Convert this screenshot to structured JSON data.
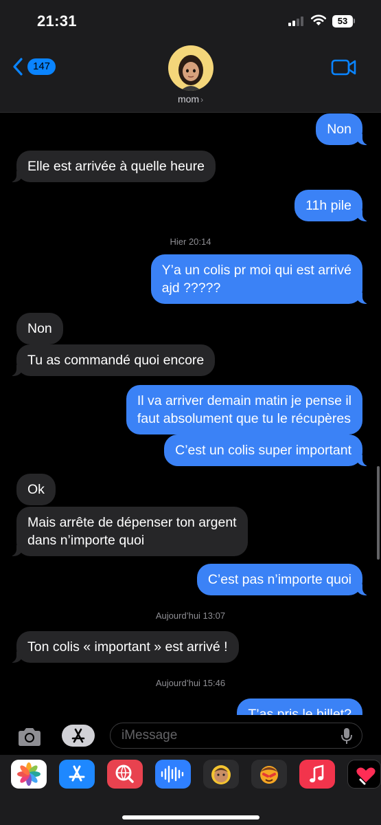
{
  "status_bar": {
    "time": "21:31",
    "battery": "53"
  },
  "header": {
    "back_count": "147",
    "contact_name": "mom"
  },
  "messages": [
    {
      "side": "out",
      "text": "Non"
    },
    {
      "side": "in",
      "text": "Elle est arrivée à quelle heure"
    },
    {
      "side": "out",
      "text": "11h pile"
    },
    {
      "timestamp": "Hier 20:14"
    },
    {
      "side": "out",
      "text": "Y’a un colis pr moi qui est arrivé\najd ?????"
    },
    {
      "side": "in",
      "text": "Non"
    },
    {
      "side": "in",
      "text": "Tu as commandé quoi encore"
    },
    {
      "side": "out",
      "text": "Il va arriver demain matin je pense il\nfaut absolument que tu le récupères"
    },
    {
      "side": "out",
      "text": "C’est un colis super important"
    },
    {
      "side": "in",
      "text": "Ok"
    },
    {
      "side": "in",
      "text": "Mais arrête de dépenser ton argent\ndans n’importe quoi"
    },
    {
      "side": "out",
      "text": "C’est pas n’importe quoi"
    },
    {
      "timestamp": "Aujourd’hui 13:07"
    },
    {
      "side": "in",
      "text": "Ton colis « important » est arrivé !"
    },
    {
      "timestamp": "Aujourd’hui 15:46"
    },
    {
      "side": "out",
      "text": "T’as pris le billet?"
    }
  ],
  "input": {
    "placeholder": "iMessage"
  },
  "app_strip": {
    "apps": [
      "photos-app",
      "app-store-app",
      "web-search-app",
      "audio-message-app",
      "memoji-app",
      "memoji-stickers-app",
      "music-app",
      "digital-touch-app"
    ]
  },
  "colors": {
    "outgoing_bubble": "#3b82f6",
    "incoming_bubble": "#262628",
    "accent": "#0a84ff"
  }
}
